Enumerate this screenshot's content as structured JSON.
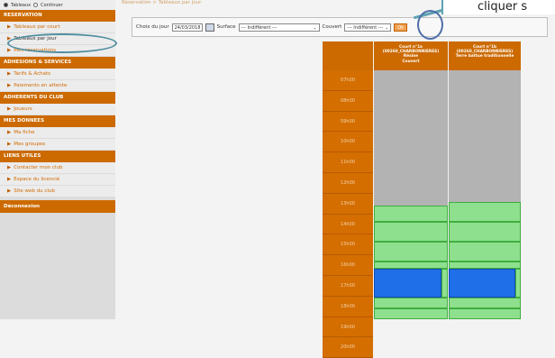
{
  "sidebar": {
    "radio_1": "Tableaux",
    "radio_2": "Continuer",
    "sections": [
      {
        "title": "RESERVATION",
        "items": [
          "Tableaux par court",
          "Tableaux par jour",
          "Mes réservations"
        ]
      },
      {
        "title": "ADHESIONS & SERVICES",
        "items": [
          "Tarifs & Achats",
          "Paiements en attente"
        ]
      },
      {
        "title": "ADHERENTS DU CLUB",
        "items": [
          "Joueurs"
        ]
      },
      {
        "title": "MES DONNEES",
        "items": [
          "Ma fiche",
          "Mes groupes"
        ]
      },
      {
        "title": "LIENS UTILES",
        "items": [
          "Contacter mon club",
          "Espace du licencié",
          "Site web du club"
        ]
      }
    ],
    "disconnect": "Déconnexion"
  },
  "breadcrumb": "Réservation > Tableaux par jour",
  "toolbar": {
    "date_label": "Choix du jour",
    "date_value": "24/03/2018",
    "surface_label": "Surface",
    "surface_value": "--- Indifférent ---",
    "covered_label": "Couvert",
    "covered_value": "--- Indifférent ---",
    "ok": "Ok"
  },
  "callout": "cliquer s",
  "courts": [
    {
      "line1": "Court n°1a",
      "line2": "(00260_CHARBONNIERES)",
      "line3": "Résine",
      "line4": "Couvert"
    },
    {
      "line1": "Court n°1b",
      "line2": "(00260_CHARBONNIERES)",
      "line3": "Terre battue traditionnelle",
      "line4": ""
    }
  ],
  "hours": [
    "07h00",
    "08h00",
    "09h00",
    "10h00",
    "11h00",
    "12h00",
    "13h00",
    "14h00",
    "15h00",
    "16h00",
    "17h00",
    "18h00",
    "19h00",
    "20h00"
  ],
  "colors": {
    "reserved": "#1f6fe8",
    "free": "#8ee08e",
    "closed": "#b3b3b3",
    "accent": "#cc6a00"
  }
}
